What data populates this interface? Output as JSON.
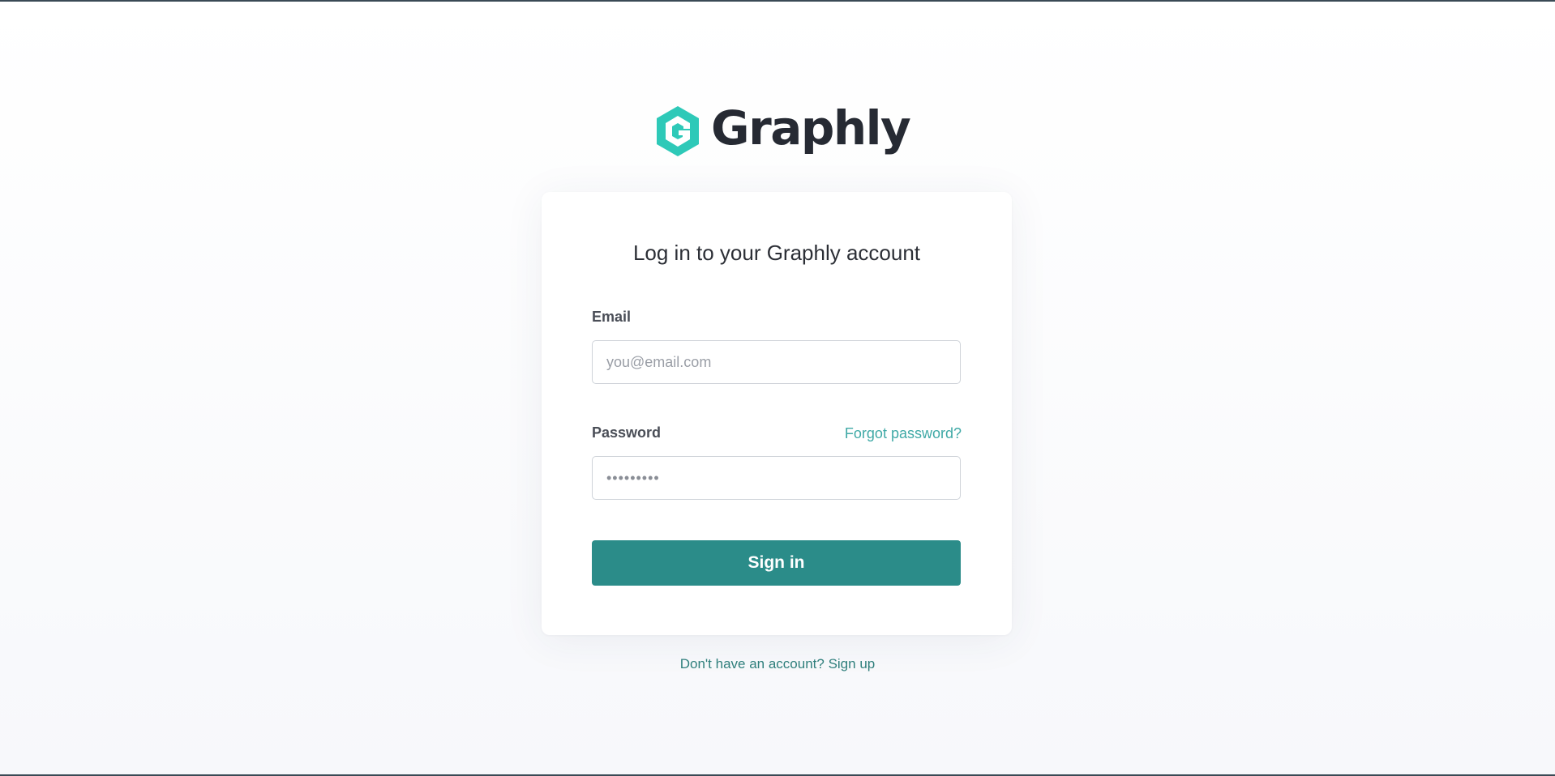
{
  "brand": {
    "name": "Graphly",
    "logo_icon": "graphly-hexagon-g-icon",
    "accent_color": "#2ec9b8",
    "text_color": "#262a33"
  },
  "login": {
    "title": "Log in to your Graphly account",
    "email_label": "Email",
    "email_value": "",
    "email_placeholder": "you@email.com",
    "password_label": "Password",
    "password_value": "•••••••••",
    "forgot_password": "Forgot password?",
    "submit_label": "Sign in",
    "button_color": "#2b8c89"
  },
  "footer": {
    "signup_text": "Don't have an account? Sign up"
  }
}
